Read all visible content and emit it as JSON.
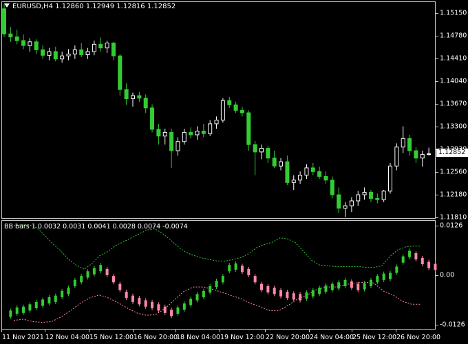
{
  "header": {
    "symbol": "EURUSD,H4",
    "open": "1.12860",
    "high": "1.12949",
    "low": "1.12816",
    "close": "1.12852"
  },
  "price_axis": {
    "ticks": [
      "1.15150",
      "1.14780",
      "1.14410",
      "1.14040",
      "1.13670",
      "1.13300",
      "1.12930",
      "1.12560",
      "1.12180",
      "1.11810"
    ],
    "current": "1.12852"
  },
  "indicator": {
    "title": "BB bars 1 0.0032 0.0031 0.0041 0.0028 0.0074 -0.0074",
    "ticks": [
      "0.0126",
      "0.00",
      "-0.0126"
    ]
  },
  "time_axis": {
    "ticks": [
      "11 Nov 2021",
      "12 Nov 04:00",
      "15 Nov 12:00",
      "16 Nov 20:00",
      "18 Nov 04:00",
      "19 Nov 12:00",
      "22 Nov 20:00",
      "24 Nov 04:00",
      "25 Nov 12:00",
      "26 Nov 20:00"
    ]
  },
  "colors": {
    "bull": "#33cc33",
    "bear": "#ffffff",
    "ind_bull": "#33cc33",
    "ind_bear": "#ff88aa",
    "upper_band": "#33cc33",
    "lower_band": "#ff88aa",
    "frame": "#c8c8c8"
  },
  "chart_data": {
    "type": "candlestick",
    "series": [
      {
        "name": "EURUSD,H4",
        "ohlc": [
          [
            1.1522,
            1.153,
            1.1476,
            1.1481
          ],
          [
            1.1481,
            1.1492,
            1.1468,
            1.1476
          ],
          [
            1.1476,
            1.1488,
            1.1464,
            1.147
          ],
          [
            1.147,
            1.148,
            1.1456,
            1.1462
          ],
          [
            1.1462,
            1.1474,
            1.1452,
            1.1468
          ],
          [
            1.1468,
            1.1472,
            1.1448,
            1.1455
          ],
          [
            1.1455,
            1.1462,
            1.144,
            1.1446
          ],
          [
            1.1446,
            1.1458,
            1.1438,
            1.1452
          ],
          [
            1.1452,
            1.146,
            1.1436,
            1.144
          ],
          [
            1.144,
            1.1452,
            1.1434,
            1.1445
          ],
          [
            1.1445,
            1.1456,
            1.1438,
            1.1448
          ],
          [
            1.1448,
            1.1462,
            1.144,
            1.1455
          ],
          [
            1.1455,
            1.1466,
            1.1443,
            1.1447
          ],
          [
            1.1447,
            1.1458,
            1.144,
            1.1452
          ],
          [
            1.1452,
            1.147,
            1.1446,
            1.1464
          ],
          [
            1.1464,
            1.1475,
            1.1452,
            1.1458
          ],
          [
            1.1458,
            1.147,
            1.145,
            1.1466
          ],
          [
            1.1466,
            1.1468,
            1.1438,
            1.1445
          ],
          [
            1.1445,
            1.1448,
            1.138,
            1.139
          ],
          [
            1.139,
            1.14,
            1.1365,
            1.1375
          ],
          [
            1.1375,
            1.1385,
            1.1362,
            1.138
          ],
          [
            1.138,
            1.1386,
            1.137,
            1.1376
          ],
          [
            1.1376,
            1.1382,
            1.1352,
            1.136
          ],
          [
            1.136,
            1.1366,
            1.132,
            1.1325
          ],
          [
            1.1325,
            1.1334,
            1.13,
            1.1314
          ],
          [
            1.1314,
            1.1326,
            1.13,
            1.132
          ],
          [
            1.132,
            1.1326,
            1.1262,
            1.129
          ],
          [
            1.129,
            1.1312,
            1.1282,
            1.1305
          ],
          [
            1.1305,
            1.1326,
            1.13,
            1.132
          ],
          [
            1.132,
            1.1328,
            1.131,
            1.1316
          ],
          [
            1.1316,
            1.133,
            1.1308,
            1.1322
          ],
          [
            1.1322,
            1.1334,
            1.1312,
            1.1318
          ],
          [
            1.1318,
            1.134,
            1.1314,
            1.1334
          ],
          [
            1.1334,
            1.1346,
            1.1326,
            1.134
          ],
          [
            1.134,
            1.1376,
            1.1336,
            1.1372
          ],
          [
            1.1372,
            1.1378,
            1.136,
            1.1365
          ],
          [
            1.1365,
            1.137,
            1.1352,
            1.1356
          ],
          [
            1.1356,
            1.1362,
            1.1346,
            1.1352
          ],
          [
            1.1352,
            1.1356,
            1.129,
            1.13
          ],
          [
            1.13,
            1.1306,
            1.125,
            1.1288
          ],
          [
            1.1288,
            1.13,
            1.1276,
            1.1294
          ],
          [
            1.1294,
            1.1298,
            1.127,
            1.1278
          ],
          [
            1.1278,
            1.129,
            1.1262,
            1.1265
          ],
          [
            1.1265,
            1.1278,
            1.1258,
            1.1272
          ],
          [
            1.1272,
            1.1282,
            1.1234,
            1.1238
          ],
          [
            1.1238,
            1.125,
            1.1226,
            1.1242
          ],
          [
            1.1242,
            1.1256,
            1.1236,
            1.125
          ],
          [
            1.125,
            1.1268,
            1.1244,
            1.1262
          ],
          [
            1.1262,
            1.127,
            1.125,
            1.1256
          ],
          [
            1.1256,
            1.1264,
            1.1244,
            1.1248
          ],
          [
            1.1248,
            1.1256,
            1.1236,
            1.1242
          ],
          [
            1.1242,
            1.1248,
            1.1212,
            1.1218
          ],
          [
            1.1218,
            1.123,
            1.1188,
            1.1196
          ],
          [
            1.1196,
            1.1206,
            1.1182,
            1.12
          ],
          [
            1.12,
            1.1214,
            1.119,
            1.1208
          ],
          [
            1.1208,
            1.1224,
            1.12,
            1.1218
          ],
          [
            1.1218,
            1.123,
            1.121,
            1.1222
          ],
          [
            1.1222,
            1.1226,
            1.1206,
            1.1212
          ],
          [
            1.1212,
            1.122,
            1.1204,
            1.121
          ],
          [
            1.121,
            1.1226,
            1.1206,
            1.1224
          ],
          [
            1.1224,
            1.127,
            1.122,
            1.1265
          ],
          [
            1.1265,
            1.1302,
            1.1258,
            1.1296
          ],
          [
            1.1296,
            1.133,
            1.1286,
            1.131
          ],
          [
            1.131,
            1.1316,
            1.1282,
            1.129
          ],
          [
            1.129,
            1.1296,
            1.127,
            1.1278
          ],
          [
            1.1278,
            1.129,
            1.1264,
            1.1284
          ],
          [
            1.1284,
            1.1295,
            1.1282,
            1.1285
          ]
        ]
      },
      {
        "name": "BB bars",
        "values": [
          -0.0098,
          -0.009,
          -0.0088,
          -0.0082,
          -0.0076,
          -0.007,
          -0.0064,
          -0.006,
          -0.0048,
          -0.004,
          -0.002,
          -0.001,
          0.0002,
          0.001,
          0.0018,
          0.0008,
          -0.001,
          -0.003,
          -0.005,
          -0.006,
          -0.0066,
          -0.0072,
          -0.0076,
          -0.0082,
          -0.0088,
          -0.0096,
          -0.009,
          -0.008,
          -0.0068,
          -0.0056,
          -0.0048,
          -0.0036,
          -0.0022,
          -0.001,
          0.0018,
          0.0022,
          0.0016,
          0.0008,
          -0.001,
          -0.003,
          -0.0036,
          -0.004,
          -0.0046,
          -0.005,
          -0.0054,
          -0.0056,
          -0.0052,
          -0.0046,
          -0.004,
          -0.0034,
          -0.003,
          -0.0026,
          -0.002,
          -0.0024,
          -0.003,
          -0.0028,
          -0.002,
          -0.001,
          -0.0004,
          -0.0002,
          0.0014,
          0.004,
          0.0054,
          0.0048,
          0.0036,
          0.0026,
          0.0021
        ]
      },
      {
        "name": "upper",
        "values": [
          0.0126,
          0.0128,
          0.0128,
          0.012,
          0.01,
          0.008,
          0.0062,
          0.004,
          0.0025,
          0.0015,
          0.003,
          0.005,
          0.006,
          0.0075,
          0.0085,
          0.0095,
          0.0105,
          0.0115,
          0.0118,
          0.0106,
          0.009,
          0.0072,
          0.0058,
          0.005,
          0.0044,
          0.004,
          0.0036,
          0.0036,
          0.004,
          0.0045,
          0.0055,
          0.007,
          0.0078,
          0.0084,
          0.0095,
          0.0092,
          0.0082,
          0.006,
          0.0038,
          0.0026,
          0.0024,
          0.0022,
          0.0022,
          0.0022,
          0.0022,
          0.002,
          0.002,
          0.0024,
          0.0048,
          0.0064,
          0.0072,
          0.0074,
          0.0074
        ]
      },
      {
        "name": "lower",
        "values": [
          -0.0115,
          -0.0112,
          -0.0118,
          -0.012,
          -0.0118,
          -0.0106,
          -0.009,
          -0.0072,
          -0.0058,
          -0.005,
          -0.0058,
          -0.007,
          -0.0084,
          -0.0096,
          -0.0102,
          -0.01,
          -0.0084,
          -0.0062,
          -0.004,
          -0.003,
          -0.003,
          -0.0036,
          -0.0044,
          -0.0052,
          -0.006,
          -0.0072,
          -0.008,
          -0.009,
          -0.009,
          -0.0076,
          -0.006,
          -0.005,
          -0.0036,
          -0.003,
          -0.003,
          -0.0024,
          -0.002,
          -0.0018,
          -0.002,
          -0.004,
          -0.005,
          -0.0066,
          -0.0074,
          -0.0074
        ]
      }
    ],
    "ylim": [
      1.1181,
      1.1535
    ],
    "ind_ylim": [
      -0.0126,
      0.0126
    ]
  }
}
